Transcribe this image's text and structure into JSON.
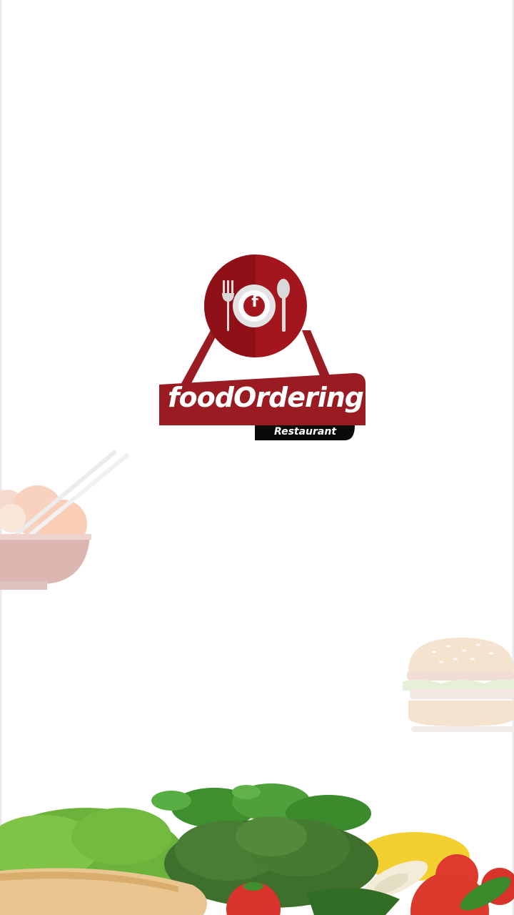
{
  "splash": {
    "brand_name": "foodOrdering",
    "brand_tagline": "Restaurant",
    "logo_letter": "f"
  },
  "colors": {
    "brand_red": "#9a1b22",
    "brand_red_dark": "#7d0f14",
    "tag_black": "#0a0a0a",
    "background": "#ffffff"
  },
  "icons": [
    "fork-icon",
    "spoon-icon",
    "plate-icon",
    "bowl-chopsticks-illustration",
    "burger-illustration",
    "vegetables-illustration"
  ]
}
